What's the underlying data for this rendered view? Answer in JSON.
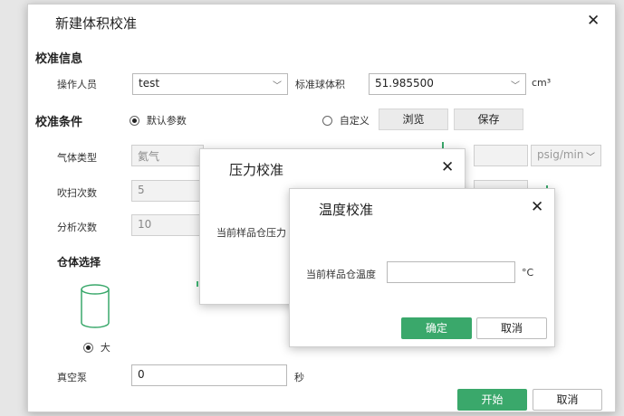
{
  "main": {
    "title": "新建体积校准",
    "calibration_info": "校准信息",
    "operator_label": "操作人员",
    "operator_value": "test",
    "std_ball_label": "标准球体积",
    "std_ball_value": "51.985500",
    "std_ball_unit": "cm³",
    "conditions_label": "校准条件",
    "default_params": "默认参数",
    "custom": "自定义",
    "browse": "浏览",
    "save": "保存",
    "gas_type_label": "气体类型",
    "gas_type_value": "氦气",
    "purge_label": "吹扫次数",
    "purge_value": "5",
    "analysis_label": "分析次数",
    "analysis_value": "10",
    "pressure_unit": "psig/min",
    "cell_select_label": "仓体选择",
    "cell_large": "大",
    "vacuum_label": "真空泵",
    "vacuum_value": "0",
    "vacuum_unit": "秒",
    "start": "开始",
    "cancel": "取消"
  },
  "pressure_dialog": {
    "title": "压力校准",
    "current_label": "当前样品仓压力"
  },
  "temp_dialog": {
    "title": "温度校准",
    "current_label": "当前样品仓温度",
    "unit": "°C",
    "confirm": "确定",
    "cancel": "取消"
  }
}
